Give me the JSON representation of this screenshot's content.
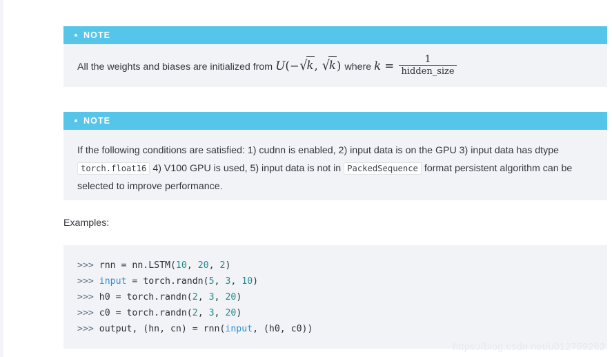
{
  "colors": {
    "note_header_bg": "#55c6ea",
    "note_body_bg": "#f2f3f7",
    "code_bg": "#f2f3f7",
    "text": "#32363c",
    "code_number": "#1f8a8a",
    "code_keyword": "#2b8fd4",
    "code_prompt": "#5a6d86",
    "watermark": "#e6e9ee",
    "page_bg": "#ffffff"
  },
  "notes": [
    {
      "label": "NOTE",
      "bullet_icon": "bullet-dot-icon",
      "text_before_math": "All the weights and biases are initialized from",
      "math": {
        "distribution": "U",
        "open_paren": "(",
        "minus": "−",
        "radical": "√",
        "arg": "k",
        "comma": ",",
        "close_paren": ")",
        "where": "where",
        "variable": "k",
        "equals": "=",
        "fraction_numerator": "1",
        "fraction_denominator": "hidden_size"
      },
      "plain_text": "All the weights and biases are initialized from U(−√k, √k) where k = 1/hidden_size"
    },
    {
      "label": "NOTE",
      "bullet_icon": "bullet-dot-icon",
      "segments": [
        {
          "type": "text",
          "value": "If the following conditions are satisfied: 1) cudnn is enabled, 2) input data is on the GPU 3) input data has dtype "
        },
        {
          "type": "code",
          "value": "torch.float16"
        },
        {
          "type": "text",
          "value": " 4) V100 GPU is used, 5) input data is not in "
        },
        {
          "type": "code",
          "value": "PackedSequence"
        },
        {
          "type": "text",
          "value": " format persistent algorithm can be selected to improve performance."
        }
      ],
      "plain_text": "If the following conditions are satisfied: 1) cudnn is enabled, 2) input data is on the GPU 3) input data has dtype torch.float16 4) V100 GPU is used, 5) input data is not in PackedSequence format persistent algorithm can be selected to improve performance."
    }
  ],
  "examples": {
    "label": "Examples:"
  },
  "code_block": {
    "language": "python",
    "lines": [
      [
        {
          "t": "prompt",
          "v": ">>> "
        },
        {
          "t": "plain",
          "v": "rnn = nn.LSTM("
        },
        {
          "t": "num",
          "v": "10"
        },
        {
          "t": "plain",
          "v": ", "
        },
        {
          "t": "num",
          "v": "20"
        },
        {
          "t": "plain",
          "v": ", "
        },
        {
          "t": "num",
          "v": "2"
        },
        {
          "t": "plain",
          "v": ")"
        }
      ],
      [
        {
          "t": "prompt",
          "v": ">>> "
        },
        {
          "t": "kw",
          "v": "input"
        },
        {
          "t": "plain",
          "v": " = torch.randn("
        },
        {
          "t": "num",
          "v": "5"
        },
        {
          "t": "plain",
          "v": ", "
        },
        {
          "t": "num",
          "v": "3"
        },
        {
          "t": "plain",
          "v": ", "
        },
        {
          "t": "num",
          "v": "10"
        },
        {
          "t": "plain",
          "v": ")"
        }
      ],
      [
        {
          "t": "prompt",
          "v": ">>> "
        },
        {
          "t": "plain",
          "v": "h0 = torch.randn("
        },
        {
          "t": "num",
          "v": "2"
        },
        {
          "t": "plain",
          "v": ", "
        },
        {
          "t": "num",
          "v": "3"
        },
        {
          "t": "plain",
          "v": ", "
        },
        {
          "t": "num",
          "v": "20"
        },
        {
          "t": "plain",
          "v": ")"
        }
      ],
      [
        {
          "t": "prompt",
          "v": ">>> "
        },
        {
          "t": "plain",
          "v": "c0 = torch.randn("
        },
        {
          "t": "num",
          "v": "2"
        },
        {
          "t": "plain",
          "v": ", "
        },
        {
          "t": "num",
          "v": "3"
        },
        {
          "t": "plain",
          "v": ", "
        },
        {
          "t": "num",
          "v": "20"
        },
        {
          "t": "plain",
          "v": ")"
        }
      ],
      [
        {
          "t": "prompt",
          "v": ">>> "
        },
        {
          "t": "plain",
          "v": "output, (hn, cn) = rnn("
        },
        {
          "t": "kw",
          "v": "input"
        },
        {
          "t": "plain",
          "v": ", (h0, c0))"
        }
      ]
    ],
    "plain_text": ">>> rnn = nn.LSTM(10, 20, 2)\n>>> input = torch.randn(5, 3, 10)\n>>> h0 = torch.randn(2, 3, 20)\n>>> c0 = torch.randn(2, 3, 20)\n>>> output, (hn, cn) = rnn(input, (h0, c0))"
  },
  "watermark": {
    "text": "https://blog.csdn.net/u012759262"
  }
}
